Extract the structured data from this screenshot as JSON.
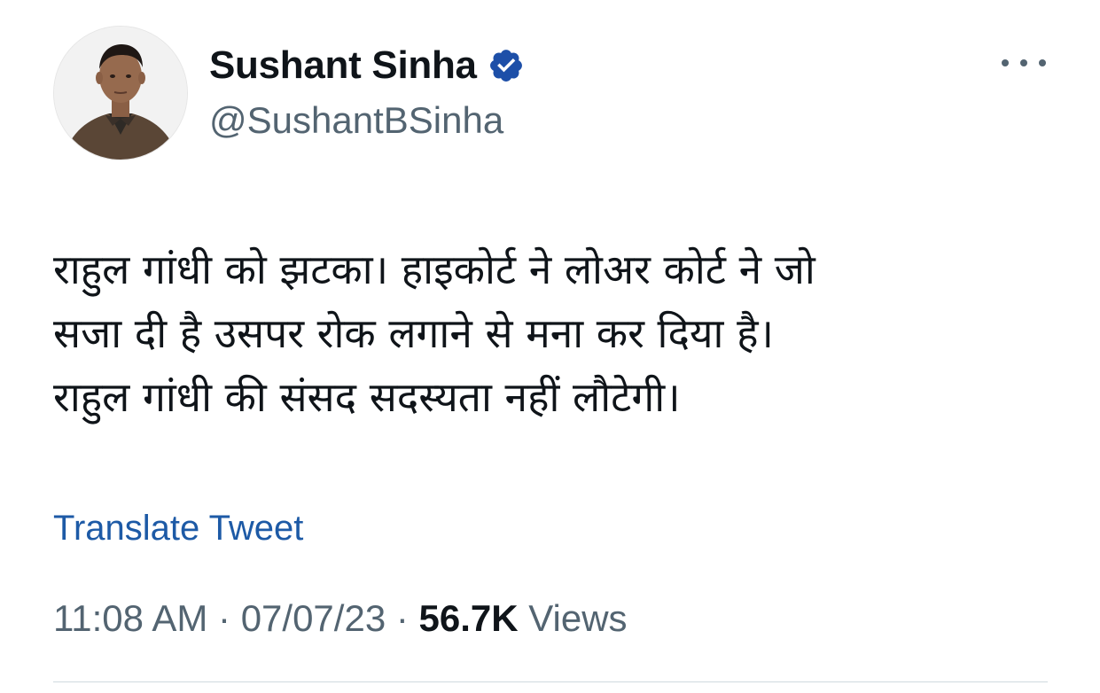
{
  "author": {
    "display_name": "Sushant Sinha",
    "handle": "@SushantBSinha",
    "verified_icon": "verified-badge-icon",
    "avatar": "profile-photo"
  },
  "tweet": {
    "lines": [
      "राहुल गांधी को झटका। हाइकोर्ट ने लोअर कोर्ट ने जो",
      "सजा दी है उसपर रोक लगाने से मना कर दिया है।",
      "राहुल गांधी की संसद सदस्यता नहीं लौटेगी।"
    ],
    "translate_label": "Translate Tweet"
  },
  "meta": {
    "time": "11:08 AM",
    "separator": "·",
    "date": "07/07/23",
    "views_count": "56.7K",
    "views_label": "Views"
  },
  "more_icon": "more-horizontal-icon",
  "colors": {
    "text_primary": "#0f1419",
    "text_secondary": "#536471",
    "link": "#1d5aa6",
    "verified": "#1d4fa8"
  }
}
